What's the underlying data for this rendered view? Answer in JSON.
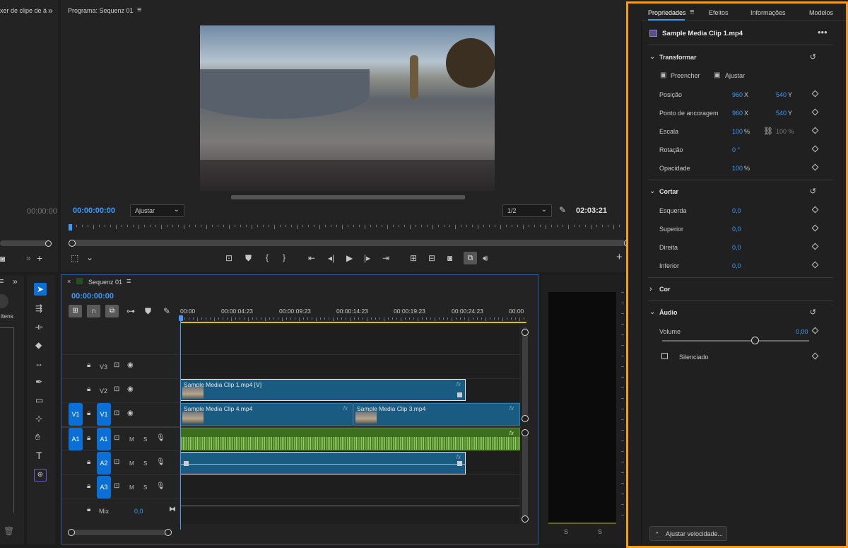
{
  "source_panel": {
    "title": "xer de clipe de á",
    "timecode": "00:00:00"
  },
  "program": {
    "title": "Programa: Sequenz 01",
    "timecode": "00:00:00:00",
    "fit_label": "Ajustar",
    "resolution": "1/2",
    "duration": "02:03:21"
  },
  "project_panel": {
    "items_label": "itens"
  },
  "timeline": {
    "title": "Sequenz 01",
    "timecode": "00:00:00:00",
    "ruler": [
      "00:00",
      "00:00:04:23",
      "00:00:09:23",
      "00:00:14:23",
      "00:00:19:23",
      "00:00:24:23",
      "00:00"
    ],
    "tracks": {
      "v3": "V3",
      "v2": "V2",
      "v1": "V1",
      "a1": "A1",
      "a2": "A2",
      "a3": "A3",
      "src_v1": "V1",
      "src_a1": "A1",
      "m": "M",
      "s": "S",
      "mix": "Mix",
      "mix_value": "0,0"
    },
    "clips": {
      "clip1": "Sample Media Clip 1.mp4 [V]",
      "clip4": "Sample Media Clip 4.mp4",
      "clip3": "Sample Media Clip 3.mp4",
      "fx": "fx"
    }
  },
  "audio_meter": {
    "s1": "S",
    "s2": "S"
  },
  "properties": {
    "tabs": [
      "Propriedades",
      "Efeitos",
      "Informações",
      "Modelos"
    ],
    "clip_name": "Sample Media Clip 1.mp4",
    "transform": {
      "title": "Transformar",
      "fill_label": "Preencher",
      "fit_label": "Ajustar",
      "position_label": "Posição",
      "position_x": "960",
      "position_y": "540",
      "anchor_label": "Ponto de ancoragem",
      "anchor_x": "960",
      "anchor_y": "540",
      "scale_label": "Escala",
      "scale_value": "100",
      "scale_value2": "100 %",
      "rotation_label": "Rotação",
      "rotation_value": "0 °",
      "opacity_label": "Opacidade",
      "opacity_value": "100",
      "unit_x": "X",
      "unit_y": "Y",
      "unit_pct": "%"
    },
    "crop": {
      "title": "Cortar",
      "left_label": "Esquerda",
      "left_value": "0,0",
      "top_label": "Superior",
      "top_value": "0,0",
      "right_label": "Direita",
      "right_value": "0,0",
      "bottom_label": "Inferior",
      "bottom_value": "0,0"
    },
    "color": {
      "title": "Cor"
    },
    "audio": {
      "title": "Áudio",
      "volume_label": "Volume",
      "volume_value": "0,00",
      "mute_label": "Silenciado"
    },
    "speed_button": "Ajustar velocidade..."
  },
  "colors": {
    "accent": "#3b9bff",
    "highlight_border": "#f39c1f",
    "track_blue": "#0a6fd6",
    "audio_green": "#3c6e1e"
  }
}
